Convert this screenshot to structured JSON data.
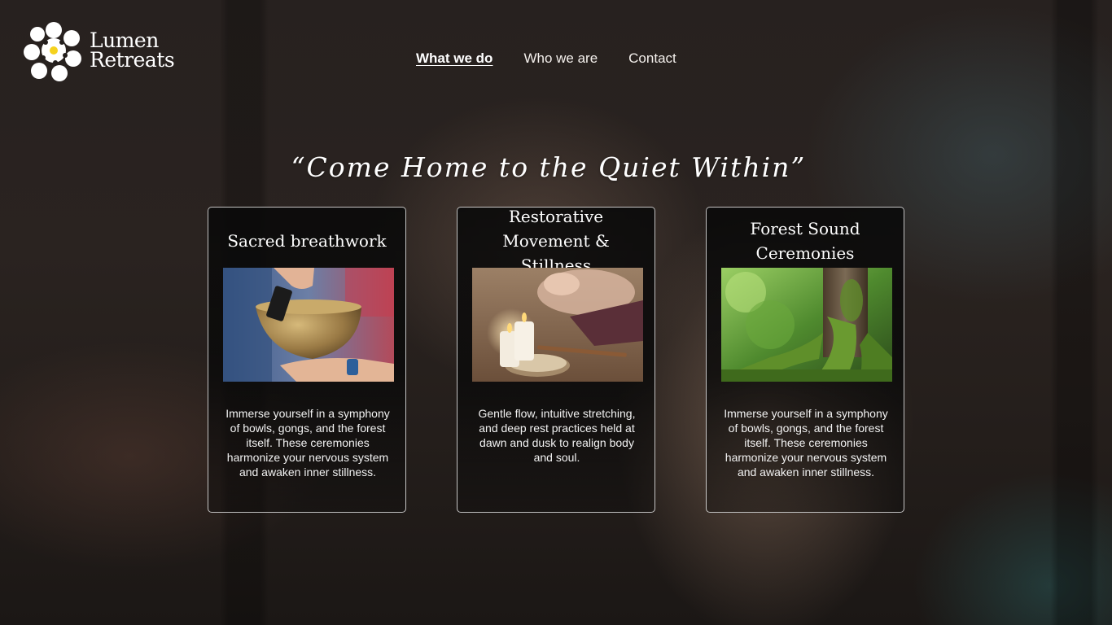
{
  "brand": {
    "line1": "Lumen",
    "line2": "Retreats"
  },
  "nav": {
    "items": [
      {
        "label": "What we do",
        "active": true
      },
      {
        "label": "Who we are",
        "active": false
      },
      {
        "label": "Contact",
        "active": false
      }
    ]
  },
  "hero": {
    "tagline": "“Come Home to the Quiet Within”"
  },
  "cards": [
    {
      "title": "Sacred breathwork",
      "image_icon": "singing-bowl-photo",
      "description": "Immerse yourself in a symphony of bowls, gongs, and the forest itself. These ceremonies harmonize your nervous system and awaken inner stillness."
    },
    {
      "title": "Restorative Movement & Stillness",
      "image_icon": "candles-meditation-photo",
      "description": "Gentle flow, intuitive stretching, and deep rest practices held at dawn and dusk to realign body and soul."
    },
    {
      "title": "Forest Sound Ceremonies",
      "image_icon": "forest-tree-roots-photo",
      "description": "Immerse yourself in a symphony of bowls, gongs, and the forest itself. These ceremonies harmonize your nervous system and awaken inner stillness."
    }
  ],
  "colors": {
    "logo_center": "#f5d21e",
    "card_border": "#e6e6e6",
    "text": "#ffffff"
  }
}
